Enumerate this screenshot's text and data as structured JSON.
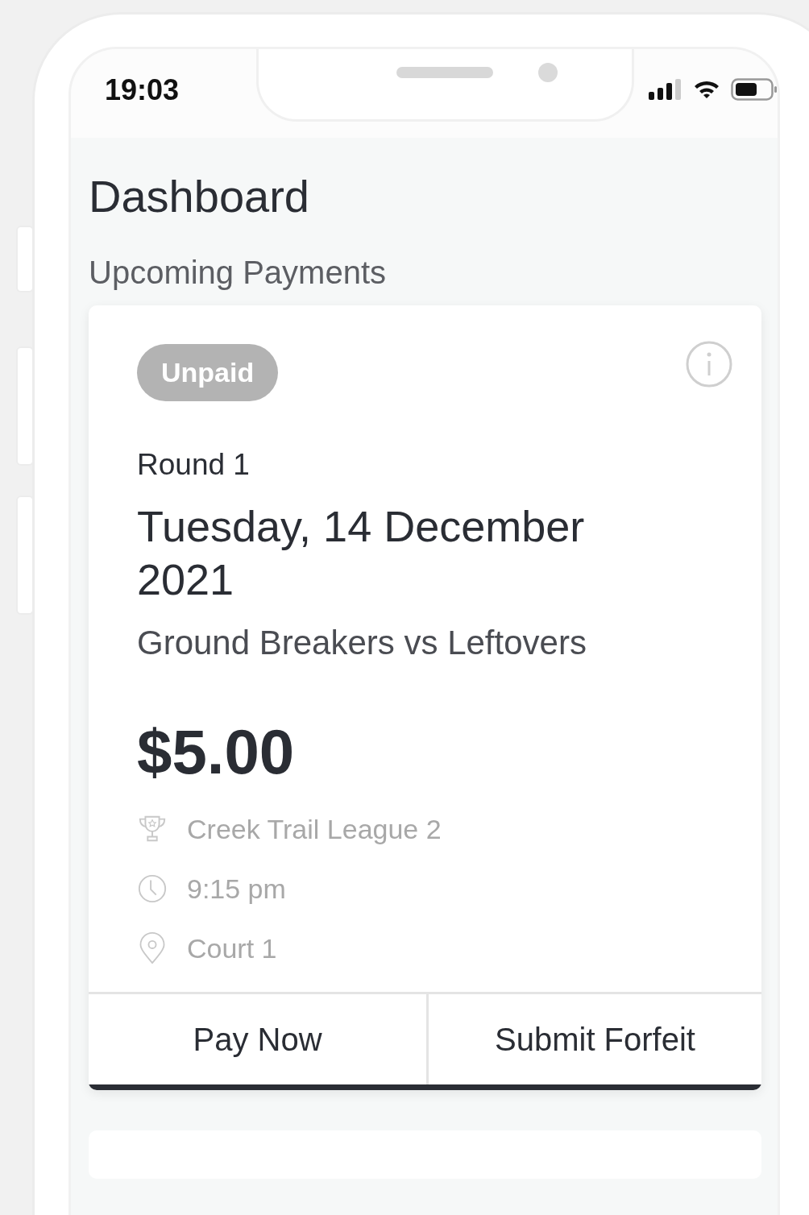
{
  "status_bar": {
    "time": "19:03"
  },
  "page": {
    "title": "Dashboard"
  },
  "section": {
    "title": "Upcoming Payments"
  },
  "payments": [
    {
      "status": {
        "label": "Unpaid",
        "kind": "unpaid"
      },
      "round": "Round 1",
      "date": "Tuesday, 14 December 2021",
      "teams": "Ground Breakers vs Leftovers",
      "amount": "$5.00",
      "details": [
        {
          "kind": "league",
          "text": "Creek Trail League 2"
        },
        {
          "kind": "time",
          "text": "9:15 pm"
        },
        {
          "kind": "venue",
          "text": "Court 1"
        }
      ],
      "actions": [
        "Pay Now",
        "Submit Forfeit"
      ]
    }
  ]
}
